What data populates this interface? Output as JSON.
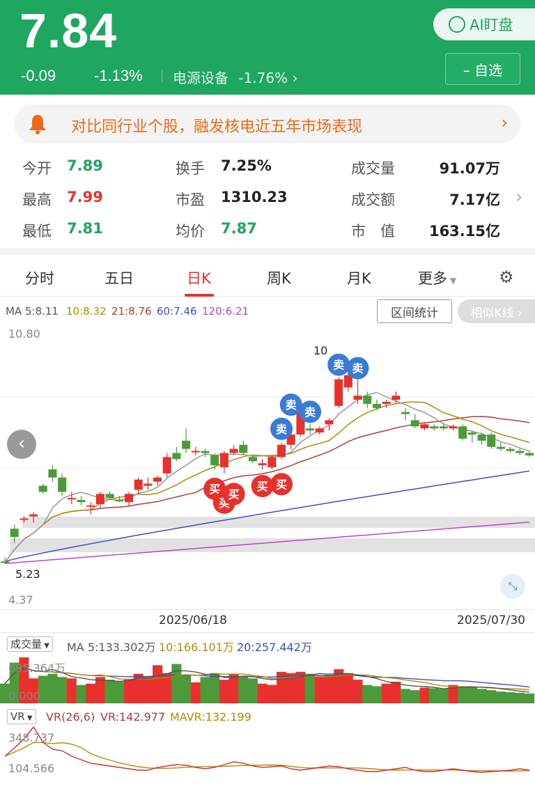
{
  "header": {
    "price": "7.84",
    "change": "-0.09",
    "change_pct": "-1.13%",
    "sector": "电源设备",
    "sector_pct": "-1.76%",
    "ai_label": "AI盯盘",
    "watch_label": "– 自选"
  },
  "alert": {
    "text": "对比同行业个股，融发核电近五年市场表现"
  },
  "stats": {
    "open_label": "今开",
    "open": "7.89",
    "high_label": "最高",
    "high": "7.99",
    "low_label": "最低",
    "low": "7.81",
    "turnover_label": "换手",
    "turnover": "7.25%",
    "pe_label": "市盈",
    "pe": "1310.23",
    "avg_label": "均价",
    "avg": "7.87",
    "vol_label": "成交量",
    "vol": "91.07万",
    "amt_label": "成交额",
    "amt": "7.17亿",
    "cap_label": "市　值",
    "cap": "163.15亿"
  },
  "tabs": [
    "分时",
    "五日",
    "日K",
    "周K",
    "月K",
    "更多"
  ],
  "chart_top": {
    "ma5": "MA 5:8.11",
    "ma10": "10:8.32",
    "ma21": "21:8.76",
    "ma60": "60:7.46",
    "ma120": "120:6.21",
    "range_btn": "区间统计",
    "similar_btn": "相似K线 ›",
    "ymax": "10.80",
    "ymin": "4.37",
    "low_mark": "5.23",
    "high_mark": "10",
    "date1": "2025/06/18",
    "date2": "2025/07/30",
    "buy": "买",
    "sell": "卖"
  },
  "volume": {
    "selector": "成交量",
    "ma5": "MA 5:133.302万",
    "ma10": "10:166.101万",
    "ma20": "20:257.442万",
    "ymax": "695.364万",
    "ymin": "0.000"
  },
  "vr": {
    "selector": "VR",
    "name": "VR(26,6)",
    "vr": "VR:142.977",
    "mavr": "MAVR:132.199",
    "ymax": "348.737",
    "ymin": "104.566"
  },
  "colors": {
    "up": "#e8302d",
    "down": "#4c9a3a",
    "green": "#1fa660"
  },
  "chart_data": {
    "type": "candlestick",
    "ylim": [
      4.37,
      10.8
    ],
    "candles": [
      [
        5.25,
        5.35,
        5.2,
        5.23
      ],
      [
        6.05,
        6.15,
        5.7,
        5.85
      ],
      [
        6.3,
        6.35,
        6.2,
        6.3
      ],
      [
        6.35,
        6.45,
        6.2,
        6.4
      ],
      [
        7.1,
        7.15,
        6.9,
        6.95
      ],
      [
        7.5,
        7.6,
        7.2,
        7.3
      ],
      [
        7.3,
        7.4,
        6.85,
        6.95
      ],
      [
        6.8,
        6.95,
        6.65,
        6.8
      ],
      [
        6.75,
        6.85,
        6.62,
        6.7
      ],
      [
        6.6,
        6.7,
        6.4,
        6.62
      ],
      [
        6.65,
        6.95,
        6.55,
        6.9
      ],
      [
        6.9,
        6.95,
        6.75,
        6.8
      ],
      [
        6.75,
        6.85,
        6.7,
        6.72
      ],
      [
        6.7,
        6.95,
        6.6,
        6.9
      ],
      [
        7.0,
        7.3,
        6.9,
        7.25
      ],
      [
        7.1,
        7.3,
        7.0,
        7.15
      ],
      [
        7.2,
        7.35,
        7.1,
        7.3
      ],
      [
        7.4,
        7.9,
        7.3,
        7.8
      ],
      [
        7.9,
        8.05,
        7.7,
        7.75
      ],
      [
        8.2,
        8.5,
        7.9,
        8.0
      ],
      [
        7.95,
        8.05,
        7.85,
        7.95
      ],
      [
        7.95,
        8.0,
        7.8,
        7.9
      ],
      [
        7.85,
        7.9,
        7.5,
        7.6
      ],
      [
        7.55,
        7.95,
        7.4,
        7.9
      ],
      [
        7.9,
        8.1,
        7.85,
        8.0
      ],
      [
        8.1,
        8.2,
        7.85,
        7.9
      ],
      [
        7.8,
        7.85,
        7.65,
        7.7
      ],
      [
        7.6,
        7.75,
        7.5,
        7.65
      ],
      [
        7.55,
        7.85,
        7.5,
        7.8
      ],
      [
        7.8,
        8.15,
        7.75,
        8.1
      ],
      [
        8.1,
        8.4,
        8.0,
        8.35
      ],
      [
        8.35,
        8.95,
        8.3,
        8.9
      ],
      [
        8.5,
        8.6,
        8.35,
        8.45
      ],
      [
        8.4,
        8.55,
        8.35,
        8.5
      ],
      [
        8.6,
        8.75,
        8.45,
        8.7
      ],
      [
        9.05,
        9.75,
        9.0,
        9.7
      ],
      [
        9.5,
        9.85,
        9.4,
        9.8
      ],
      [
        9.2,
        9.7,
        9.1,
        9.3
      ],
      [
        9.3,
        9.4,
        9.0,
        9.1
      ],
      [
        9.1,
        9.2,
        8.95,
        9.0
      ],
      [
        9.1,
        9.2,
        9.0,
        9.15
      ],
      [
        9.2,
        9.4,
        9.1,
        9.3
      ],
      [
        8.9,
        9.0,
        8.7,
        8.85
      ],
      [
        8.7,
        8.85,
        8.5,
        8.55
      ],
      [
        8.5,
        8.65,
        8.45,
        8.6
      ],
      [
        8.55,
        8.6,
        8.45,
        8.5
      ],
      [
        8.55,
        8.65,
        8.45,
        8.5
      ],
      [
        8.5,
        8.6,
        8.45,
        8.55
      ],
      [
        8.55,
        8.6,
        8.2,
        8.25
      ],
      [
        8.4,
        8.45,
        8.15,
        8.35
      ],
      [
        8.35,
        8.4,
        8.1,
        8.2
      ],
      [
        8.35,
        8.4,
        8.0,
        8.05
      ],
      [
        8.05,
        8.15,
        7.95,
        8.0
      ],
      [
        8.0,
        8.05,
        7.9,
        7.95
      ],
      [
        7.95,
        8.0,
        7.85,
        7.9
      ],
      [
        7.9,
        7.95,
        7.8,
        7.84
      ]
    ]
  }
}
